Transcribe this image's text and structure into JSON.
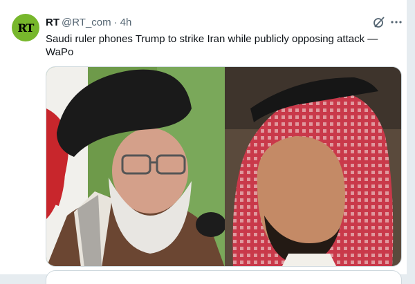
{
  "tweet": {
    "author_name": "RT",
    "handle": "@RT_com",
    "separator": "·",
    "time": "4h",
    "text": "Saudi ruler phones Trump to strike Iran while publicly opposing attack — WaPo",
    "avatar_text": "RT",
    "avatar_color": "#77b72c",
    "media_description_icons": [
      "grok-icon",
      "more-icon"
    ]
  },
  "colors": {
    "text": "#0f1419",
    "secondary": "#536471",
    "border": "#cfd9de",
    "background": "#e6ecf0"
  }
}
